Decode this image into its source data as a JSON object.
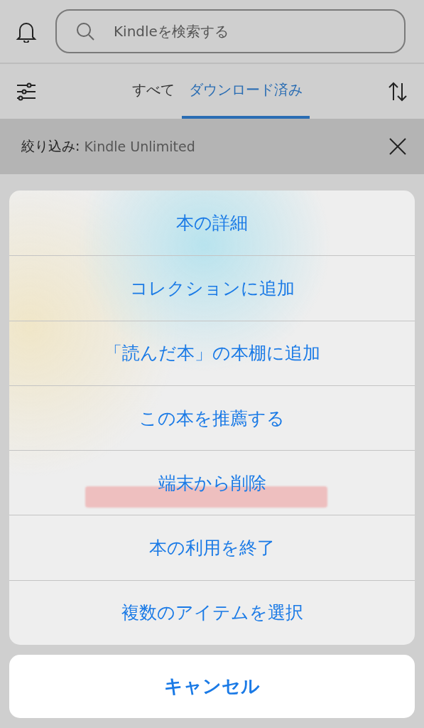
{
  "search": {
    "placeholder": "Kindleを検索する"
  },
  "tabs": [
    {
      "label": "すべて",
      "selected": false
    },
    {
      "label": "ダウンロード済み",
      "selected": true
    }
  ],
  "filter": {
    "label": "絞り込み:",
    "value": "Kindle Unlimited"
  },
  "action_sheet": {
    "items": [
      {
        "label": "本の詳細",
        "highlighted": false
      },
      {
        "label": "コレクションに追加",
        "highlighted": false
      },
      {
        "label": "「読んだ本」の本棚に追加",
        "highlighted": false
      },
      {
        "label": "この本を推薦する",
        "highlighted": false
      },
      {
        "label": "端末から削除",
        "highlighted": true
      },
      {
        "label": "本の利用を終了",
        "highlighted": false
      },
      {
        "label": "複数のアイテムを選択",
        "highlighted": false
      }
    ],
    "cancel": "キャンセル"
  }
}
